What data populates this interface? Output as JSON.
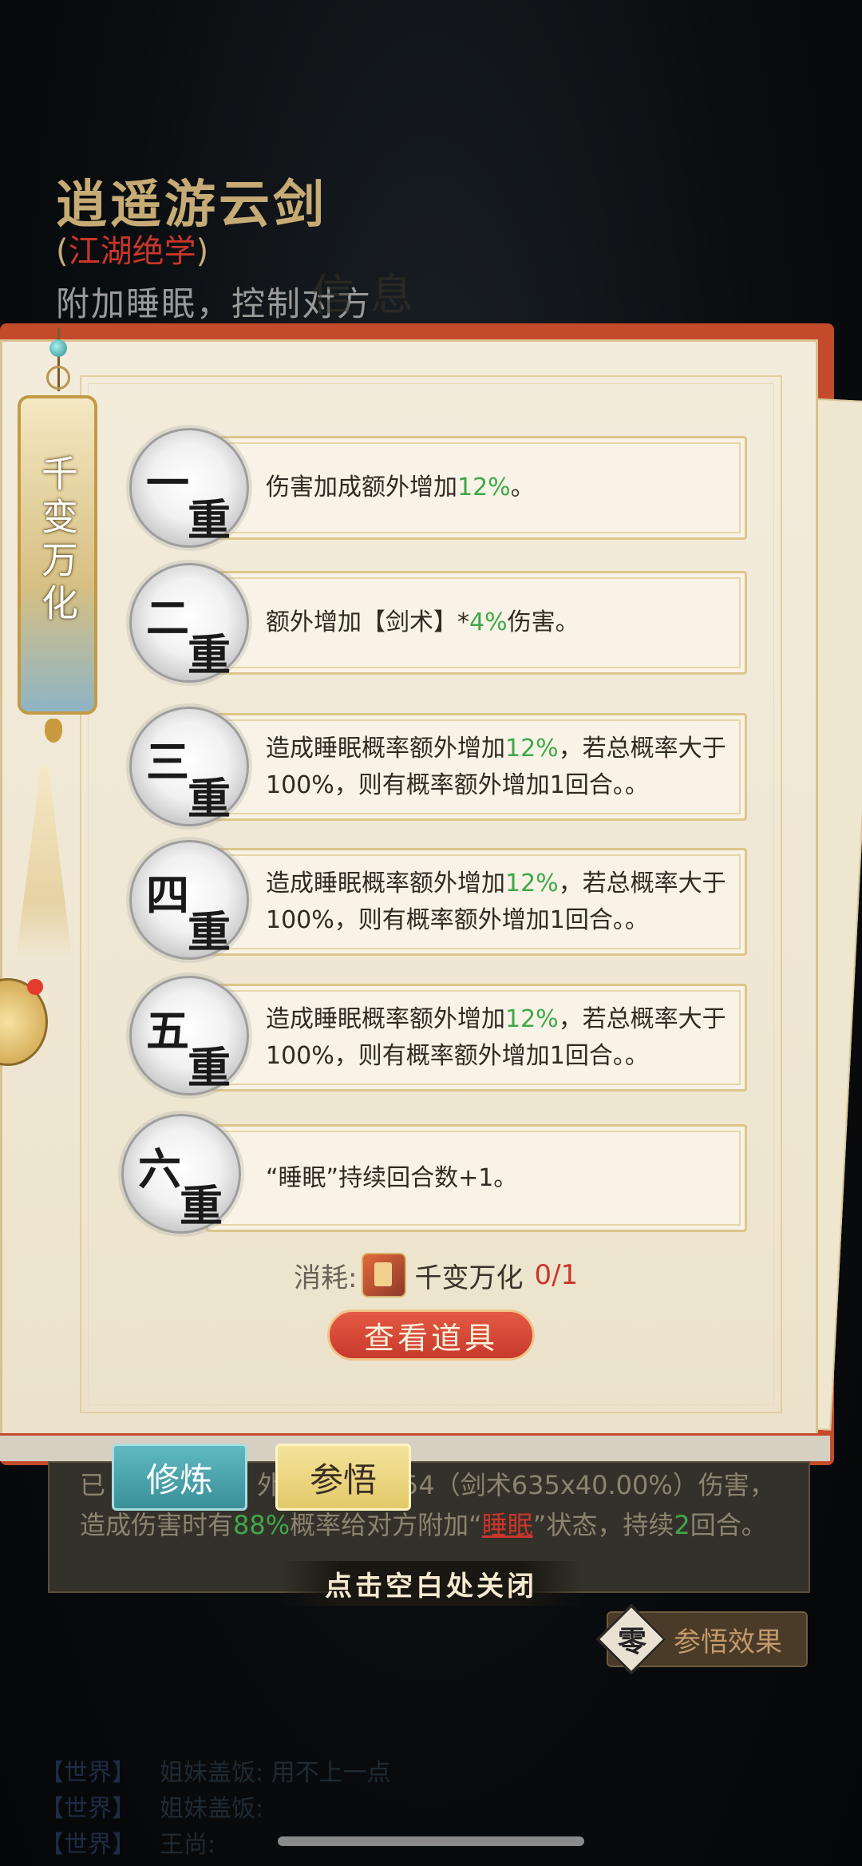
{
  "skill": {
    "name": "逍遥游云剑",
    "type_open": "(",
    "type": "江湖绝学",
    "type_close": ")",
    "effect": "附加睡眠，控制对方",
    "ghost_title": "信息"
  },
  "tag": {
    "label": "千变万化"
  },
  "tiers": [
    {
      "c1": "一",
      "c2": "重",
      "text": "伤害加成额外增加",
      "pct": "12%",
      "tail": "。"
    },
    {
      "c1": "二",
      "c2": "重",
      "text": "额外增加【剑术】*",
      "pct": "4%",
      "tail": "伤害。"
    },
    {
      "c1": "三",
      "c2": "重",
      "text": "造成睡眠概率额外增加",
      "pct": "12%",
      "tail": "，若总概率大于100%，则有概率额外增加1回合。。"
    },
    {
      "c1": "四",
      "c2": "重",
      "text": "造成睡眠概率额外增加",
      "pct": "12%",
      "tail": "，若总概率大于100%，则有概率额外增加1回合。。"
    },
    {
      "c1": "五",
      "c2": "重",
      "text": "造成睡眠概率额外增加",
      "pct": "12%",
      "tail": "，若总概率大于100%，则有概率额外增加1回合。。"
    },
    {
      "c1": "六",
      "c2": "重",
      "text": "“睡眠”持续回合数+1。",
      "pct": "",
      "tail": ""
    }
  ],
  "cost": {
    "label": "消耗:",
    "item_name": "千变万化",
    "count": "0/1"
  },
  "buttons": {
    "view_item": "查看道具",
    "tab_train": "修炼",
    "tab_insight": "参悟",
    "insight_effect": "参悟效果",
    "insight_level": "零"
  },
  "description": {
    "p1": "已",
    "p1b": "外",
    "p1c": "54（剑术635x40.00%）伤害，造成伤害时有",
    "pct": "88%",
    "p2": "概率给对方附加“",
    "status": "睡眠",
    "p3": "”状态，持续",
    "turns": "2",
    "p4": "回合。"
  },
  "close_hint": "点击空白处关闭",
  "chat": [
    {
      "channel": "【世界】",
      "msg": "姐妹盖饭: 用不上一点"
    },
    {
      "channel": "【世界】",
      "msg": "姐妹盖饭:"
    },
    {
      "channel": "【世界】",
      "msg": "王尚:"
    }
  ],
  "colors": {
    "gold": "#c7ab75",
    "red": "#c9362a",
    "green": "#3fa84a",
    "book_red": "#c44a2c"
  }
}
